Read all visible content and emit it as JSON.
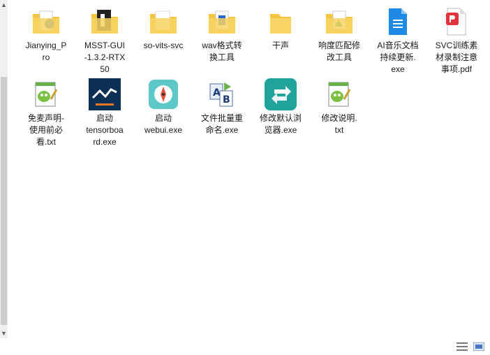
{
  "files": [
    {
      "name": "Jianying_P\nro",
      "icon": "folder-photo-icon"
    },
    {
      "name": "MSST-GUI\n-1.3.2-RTX\n50",
      "icon": "folder-dark-icon"
    },
    {
      "name": "so-vits-svc",
      "icon": "folder-icon"
    },
    {
      "name": "wav格式转\n换工具",
      "icon": "folder-blue-doc-icon"
    },
    {
      "name": "干声",
      "icon": "folder-icon"
    },
    {
      "name": "响度匹配修\n改工具",
      "icon": "folder-green-icon"
    },
    {
      "name": "AI音乐文档\n持续更新.\nexe",
      "icon": "blue-document-icon"
    },
    {
      "name": "SVC训练素\n材录制注意\n事项.pdf",
      "icon": "pdf-icon"
    },
    {
      "name": "免麦声明-\n使用前必\n看.txt",
      "icon": "notepad-icon"
    },
    {
      "name": "启动\ntensorboa\nrd.exe",
      "icon": "tensorboard-icon"
    },
    {
      "name": "启动\nwebui.exe",
      "icon": "compass-icon"
    },
    {
      "name": "文件批量重\n命名.exe",
      "icon": "rename-ab-icon"
    },
    {
      "name": "修改默认浏\n览器.exe",
      "icon": "browser-switch-icon"
    },
    {
      "name": "修改说明.\ntxt",
      "icon": "notepad-icon"
    }
  ],
  "colors": {
    "folder": "#f5c542",
    "accent": "#1fa39a",
    "navy": "#0c2f55",
    "pdf": "#e1333b"
  }
}
